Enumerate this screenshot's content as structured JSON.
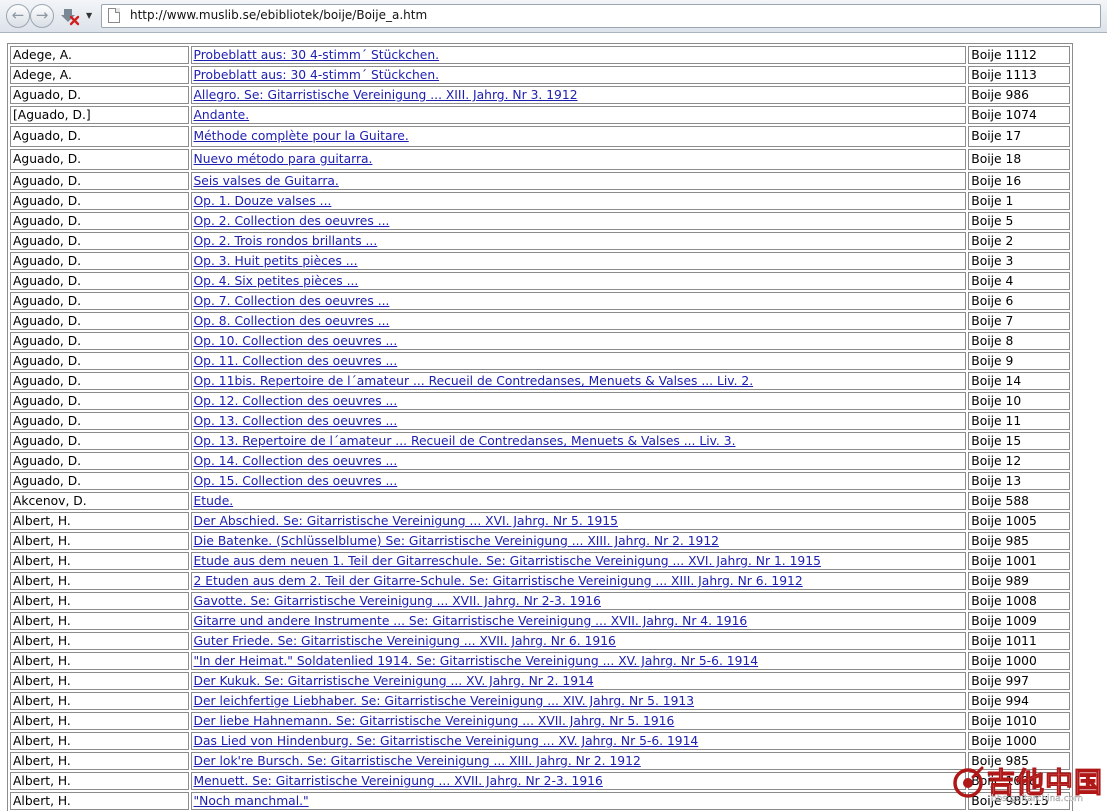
{
  "browser": {
    "url": "http://www.muslib.se/ebibliotek/boije/Boije_a.htm"
  },
  "catalog": {
    "rows": [
      {
        "composer": "Adege, A.",
        "title": "Probeblatt aus: 30 4-stimm´ Stückchen.",
        "shelfmark": "Boije 1112"
      },
      {
        "composer": "Adege, A.",
        "title": "Probeblatt aus: 30 4-stimm´ Stückchen.",
        "shelfmark": "Boije 1113"
      },
      {
        "composer": "Aguado, D.",
        "title": "Allegro. Se: Gitarristische Vereinigung ... XIII. Jahrg. Nr 3. 1912",
        "shelfmark": "Boije 986"
      },
      {
        "composer": "[Aguado, D.]",
        "title": "Andante.",
        "shelfmark": "Boije 1074"
      },
      {
        "composer": "Aguado, D.",
        "title": "Méthode complète pour la Guitare.",
        "shelfmark": "Boije 17",
        "tall": true
      },
      {
        "composer": "Aguado, D.",
        "title": "Nuevo método para guitarra.",
        "shelfmark": "Boije 18",
        "tall": true
      },
      {
        "composer": "Aguado, D.",
        "title": "Seis valses de Guitarra.",
        "shelfmark": "Boije 16"
      },
      {
        "composer": "Aguado, D.",
        "title": "Op. 1. Douze valses ...",
        "shelfmark": "Boije 1"
      },
      {
        "composer": "Aguado, D.",
        "title": "Op. 2. Collection des oeuvres ...",
        "shelfmark": "Boije 5"
      },
      {
        "composer": "Aguado, D.",
        "title": "Op. 2. Trois rondos brillants ...",
        "shelfmark": "Boije 2"
      },
      {
        "composer": "Aguado, D.",
        "title": "Op. 3. Huit petits pièces ...",
        "shelfmark": "Boije 3"
      },
      {
        "composer": "Aguado, D.",
        "title": "Op. 4. Six petites pièces ...",
        "shelfmark": "Boije 4"
      },
      {
        "composer": "Aguado, D.",
        "title": "Op. 7. Collection des oeuvres ...",
        "shelfmark": "Boije 6"
      },
      {
        "composer": "Aguado, D.",
        "title": "Op. 8. Collection des oeuvres ...",
        "shelfmark": "Boije 7"
      },
      {
        "composer": "Aguado, D.",
        "title": "Op. 10. Collection des oeuvres ...",
        "shelfmark": "Boije 8"
      },
      {
        "composer": "Aguado, D.",
        "title": "Op. 11. Collection des oeuvres ...",
        "shelfmark": "Boije 9"
      },
      {
        "composer": "Aguado, D.",
        "title": "Op. 11bis. Repertoire de l´amateur ... Recueil de Contredanses, Menuets & Valses ... Liv. 2.",
        "shelfmark": "Boije 14"
      },
      {
        "composer": "Aguado, D.",
        "title": "Op. 12. Collection des oeuvres ...",
        "shelfmark": "Boije 10"
      },
      {
        "composer": "Aguado, D.",
        "title": "Op. 13. Collection des oeuvres ...",
        "shelfmark": "Boije 11"
      },
      {
        "composer": "Aguado, D.",
        "title": "Op. 13. Repertoire de l´amateur ... Recueil de Contredanses, Menuets & Valses ... Liv. 3.",
        "shelfmark": "Boije 15"
      },
      {
        "composer": "Aguado, D.",
        "title": "Op. 14. Collection des oeuvres ...",
        "shelfmark": "Boije 12"
      },
      {
        "composer": "Aguado, D.",
        "title": "Op. 15. Collection des oeuvres ...",
        "shelfmark": "Boije 13"
      },
      {
        "composer": "Akcenov, D.",
        "title": "Etude.",
        "shelfmark": "Boije 588"
      },
      {
        "composer": "Albert, H.",
        "title": "Der Abschied. Se: Gitarristische Vereinigung ... XVI. Jahrg. Nr 5. 1915",
        "shelfmark": "Boije 1005"
      },
      {
        "composer": "Albert, H.",
        "title": "Die Batenke. (Schlüsselblume) Se: Gitarristische Vereinigung ... XIII. Jahrg. Nr 2. 1912",
        "shelfmark": "Boije 985"
      },
      {
        "composer": "Albert, H.",
        "title": "Etude aus dem neuen 1. Teil der Gitarreschule. Se: Gitarristische Vereinigung ... XVI. Jahrg. Nr 1. 1915",
        "shelfmark": "Boije 1001"
      },
      {
        "composer": "Albert, H.",
        "title": "2 Etuden aus dem 2. Teil der Gitarre-Schule. Se: Gitarristische Vereinigung ... XIII. Jahrg. Nr 6. 1912",
        "shelfmark": "Boije 989"
      },
      {
        "composer": "Albert, H.",
        "title": "Gavotte. Se: Gitarristische Vereinigung ... XVII. Jahrg. Nr 2-3. 1916",
        "shelfmark": "Boije 1008"
      },
      {
        "composer": "Albert, H.",
        "title": "Gitarre und andere Instrumente ... Se: Gitarristische Vereinigung ... XVII. Jahrg. Nr 4. 1916",
        "shelfmark": "Boije 1009"
      },
      {
        "composer": "Albert, H.",
        "title": "Guter Friede. Se: Gitarristische Vereinigung ... XVII. Jahrg. Nr 6. 1916",
        "shelfmark": "Boije 1011"
      },
      {
        "composer": "Albert, H.",
        "title": "\"In der Heimat.\" Soldatenlied 1914. Se: Gitarristische Vereinigung ... XV. Jahrg. Nr 5-6. 1914",
        "shelfmark": "Boije 1000"
      },
      {
        "composer": "Albert, H.",
        "title": "Der Kukuk. Se: Gitarristische Vereinigung ... XV. Jahrg. Nr 2. 1914",
        "shelfmark": "Boije 997"
      },
      {
        "composer": "Albert, H.",
        "title": "Der leichfertige Liebhaber. Se: Gitarristische Vereinigung ... XIV. Jahrg. Nr 5. 1913",
        "shelfmark": "Boije 994"
      },
      {
        "composer": "Albert, H.",
        "title": "Der liebe Hahnemann. Se: Gitarristische Vereinigung ... XVII. Jahrg. Nr 5. 1916",
        "shelfmark": "Boije 1010"
      },
      {
        "composer": "Albert, H.",
        "title": "Das Lied von Hindenburg. Se: Gitarristische Vereinigung ... XV. Jahrg. Nr 5-6. 1914",
        "shelfmark": "Boije 1000"
      },
      {
        "composer": "Albert, H.",
        "title": "Der lok're Bursch. Se: Gitarristische Vereinigung ... XIII. Jahrg. Nr 2. 1912",
        "shelfmark": "Boije 985"
      },
      {
        "composer": "Albert, H.",
        "title": "Menuett. Se: Gitarristische Vereinigung ... XVII. Jahrg. Nr 2-3. 1916",
        "shelfmark": "Boije 1008"
      },
      {
        "composer": "Albert, H.",
        "title": "\"Noch manchmal.\"",
        "shelfmark": "Boije 985:15"
      }
    ]
  },
  "watermark": {
    "text": "吉他中国",
    "subtext": "bbs.guitarchina.com"
  },
  "colors": {
    "link": "#2020b0",
    "border": "#8c8c8c",
    "watermark": "#b01818"
  }
}
